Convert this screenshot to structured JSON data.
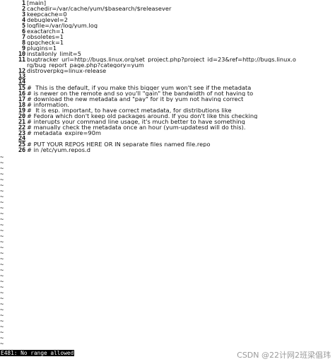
{
  "editor": {
    "lines": [
      {
        "num": "1",
        "text": "[main]"
      },
      {
        "num": "2",
        "text": "cachedir=/var/cache/yum/$basearch/$releasever"
      },
      {
        "num": "3",
        "text": "keepcache=0"
      },
      {
        "num": "4",
        "text": "debuglevel=2"
      },
      {
        "num": "5",
        "text": "logfile=/var/log/yum.log"
      },
      {
        "num": "6",
        "text": "exactarch=1"
      },
      {
        "num": "7",
        "text": "obsoletes=1"
      },
      {
        "num": "8",
        "text": "gpgcheck=1"
      },
      {
        "num": "9",
        "text": "plugins=1"
      },
      {
        "num": "10",
        "text": "installonly_limit=5"
      },
      {
        "num": "11",
        "text": "bugtracker_url=http://bugs.linux.org/set_project.php?project_id=23&ref=http://bugs.linux.o"
      },
      {
        "num": "",
        "text": "rg/bug_report_page.php?category=yum"
      },
      {
        "num": "12",
        "text": "distroverpkg=linux-release"
      },
      {
        "num": "13",
        "text": ""
      },
      {
        "num": "14",
        "text": ""
      },
      {
        "num": "15",
        "text": "#  This is the default, if you make this bigger yum won't see if the metadata"
      },
      {
        "num": "16",
        "text": "# is newer on the remote and so you'll \"gain\" the bandwidth of not having to"
      },
      {
        "num": "17",
        "text": "# download the new metadata and \"pay\" for it by yum not having correct"
      },
      {
        "num": "18",
        "text": "# information."
      },
      {
        "num": "19",
        "text": "#  It is esp. important, to have correct metadata, for distributions like"
      },
      {
        "num": "20",
        "text": "# Fedora which don't keep old packages around. If you don't like this checking"
      },
      {
        "num": "21",
        "text": "# interupts your command line usage, it's much better to have something"
      },
      {
        "num": "22",
        "text": "# manually check the metadata once an hour (yum-updatesd will do this)."
      },
      {
        "num": "23",
        "text": "# metadata_expire=90m"
      },
      {
        "num": "24",
        "text": ""
      },
      {
        "num": "25",
        "text": "# PUT YOUR REPOS HERE OR IN separate files named file.repo"
      },
      {
        "num": "26",
        "text": "# in /etc/yum.repos.d"
      }
    ],
    "tilde_char": "~"
  },
  "status_line": "E481: No range allowed",
  "watermark": "CSDN @22计网2班梁倡玮"
}
